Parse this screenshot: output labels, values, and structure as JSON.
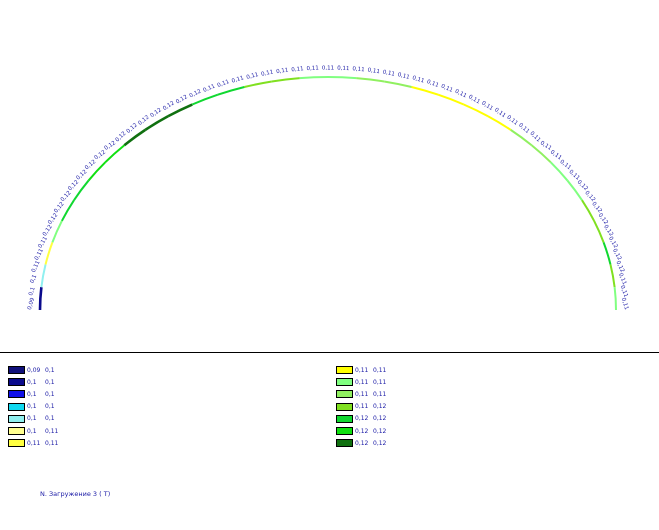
{
  "legend_left": [
    {
      "from": "0,09",
      "to": "0,1",
      "color": "#10107a"
    },
    {
      "from": "0,1",
      "to": "0,1",
      "color": "#0a0a8c"
    },
    {
      "from": "0,1",
      "to": "0,1",
      "color": "#1010e8"
    },
    {
      "from": "0,1",
      "to": "0,1",
      "color": "#10d8f0"
    },
    {
      "from": "0,1",
      "to": "0,1",
      "color": "#90f0f0"
    },
    {
      "from": "0,1",
      "to": "0,11",
      "color": "#ffff90"
    },
    {
      "from": "0,11",
      "to": "0,11",
      "color": "#ffff40"
    }
  ],
  "legend_right": [
    {
      "from": "0,11",
      "to": "0,11",
      "color": "#ffff00"
    },
    {
      "from": "0,11",
      "to": "0,11",
      "color": "#80ff80"
    },
    {
      "from": "0,11",
      "to": "0,11",
      "color": "#90f060"
    },
    {
      "from": "0,11",
      "to": "0,12",
      "color": "#80e020"
    },
    {
      "from": "0,12",
      "to": "0,12",
      "color": "#10d830"
    },
    {
      "from": "0,12",
      "to": "0,12",
      "color": "#10e010"
    },
    {
      "from": "0,12",
      "to": "0,12",
      "color": "#107010"
    }
  ],
  "arch": {
    "labels": [
      "0,09",
      "0,1",
      "0,1",
      "0,11",
      "0,11",
      "0,11",
      "0,12",
      "0,12",
      "0,12",
      "0,12",
      "0,12",
      "0,12",
      "0,12",
      "0,12",
      "0,12",
      "0,12",
      "0,12",
      "0,12",
      "0,12",
      "0,12",
      "0,12",
      "0,12",
      "0,11",
      "0,11",
      "0,11",
      "0,11",
      "0,11",
      "0,11",
      "0,11",
      "0,11",
      "0,11",
      "0,11",
      "0,11",
      "0,11",
      "0,11",
      "0,11",
      "0,11",
      "0,11",
      "0,11",
      "0,11",
      "0,11",
      "0,11",
      "0,11",
      "0,11",
      "0,11",
      "0,11",
      "0,11",
      "0,11",
      "0,11",
      "0,11",
      "0,12",
      "0,12",
      "0,12",
      "0,12",
      "0,12",
      "0,12",
      "0,12",
      "0,12",
      "0,11",
      "0,11",
      "0,11"
    ],
    "segment_colors": [
      "#0a0a8c",
      "#90f0f0",
      "#ffff40",
      "#80ff80",
      "#10d830",
      "#10d830",
      "#10e010",
      "#10e010",
      "#107010",
      "#107010",
      "#107010",
      "#10d830",
      "#10d830",
      "#80e020",
      "#80e020",
      "#80ff80",
      "#80ff80",
      "#90f060",
      "#90f060",
      "#ffff00",
      "#ffff00",
      "#ffff00",
      "#ffff00",
      "#90f060",
      "#90f060",
      "#80ff80",
      "#80ff80",
      "#80e020",
      "#80e020",
      "#10d830",
      "#80e020",
      "#80ff80"
    ]
  },
  "caption": "N. Загружение 3 ( T)"
}
